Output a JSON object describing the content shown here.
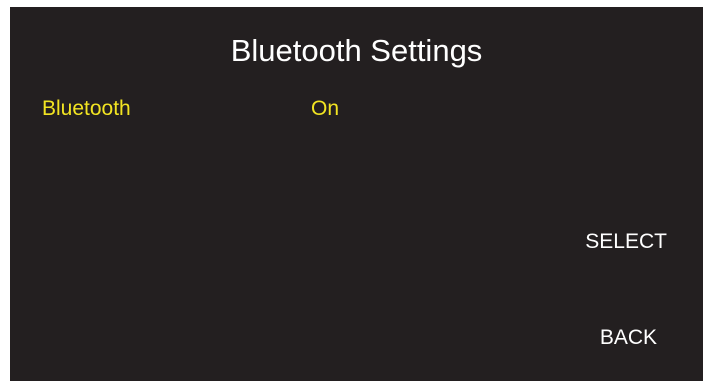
{
  "screen": {
    "title": "Bluetooth Settings",
    "colors": {
      "background": "#231f20",
      "highlight": "#f2e422",
      "text": "#ffffff"
    }
  },
  "menu": {
    "items": [
      {
        "label": "Bluetooth",
        "value": "On",
        "selected": true
      }
    ]
  },
  "softkeys": {
    "select": "SELECT",
    "back": "BACK"
  }
}
